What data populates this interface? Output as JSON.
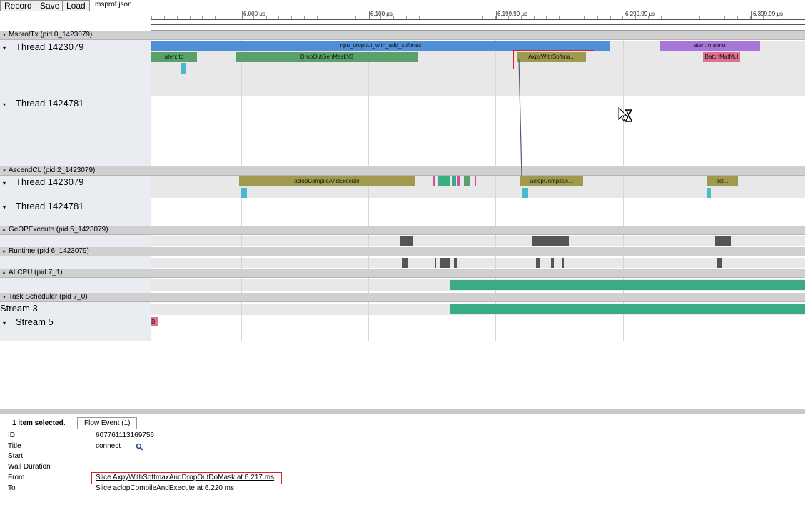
{
  "toolbar": {
    "record_label": "Record",
    "save_label": "Save",
    "load_label": "Load",
    "file_name": "msprof.json"
  },
  "ruler": {
    "ticks": [
      "6,000 μs",
      "6,100 μs",
      "6,199.99 μs",
      "6,299.99 μs",
      "6,399.99 μs"
    ]
  },
  "processes": [
    {
      "label": "MsprofTx (pid 0_1423079)",
      "threads": [
        "Thread 1423079",
        "Thread 1424781"
      ]
    },
    {
      "label": "AscendCL (pid 2_1423079)",
      "threads": [
        "Thread 1423079",
        "Thread 1424781"
      ]
    },
    {
      "label": "GeOPExecute (pid 5_1423079)"
    },
    {
      "label": "Runtime (pid 6_1423079)"
    },
    {
      "label": "AI CPU (pid 7_1)"
    },
    {
      "label": "Task Scheduler (pid 7_0)",
      "threads": [
        "Stream 3",
        "Stream 5"
      ]
    }
  ],
  "slices": {
    "npu_dropout": "npu_dropout_with_add_softmax",
    "aten_to": "aten::to",
    "dropout_gen": "DropOutGenMaskV3",
    "axpy": "AxpyWithSoftma...",
    "aten_matmul": "aten::matmul",
    "batch_matmul": "BatchMatMul",
    "aclop1": "aclopCompileAndExecute",
    "aclop2": "aclopCompileA...",
    "aclop3": "acl...",
    "stream5_b": "B"
  },
  "colors": {
    "blue": "#4f8fd8",
    "green": "#5aa06a",
    "teal_green": "#3aab83",
    "olive": "#a09a4e",
    "purple": "#a876d8",
    "pink": "#e07090",
    "cyan": "#4cb8cc",
    "dark": "#555555",
    "red_box": "#e02020"
  },
  "details": {
    "selected_count": "1 item selected.",
    "tab_label": "Flow Event (1)",
    "rows": [
      {
        "key": "ID",
        "value": "607761113169756"
      },
      {
        "key": "Title",
        "value": "connect"
      },
      {
        "key": "Start",
        "value": ""
      },
      {
        "key": "Wall Duration",
        "value": ""
      },
      {
        "key": "From",
        "value": "Slice AxpyWithSoftmaxAndDropOutDoMask at 6.217 ms"
      },
      {
        "key": "To",
        "value": "Slice aclopCompileAndExecute at 6.220 ms"
      }
    ]
  }
}
